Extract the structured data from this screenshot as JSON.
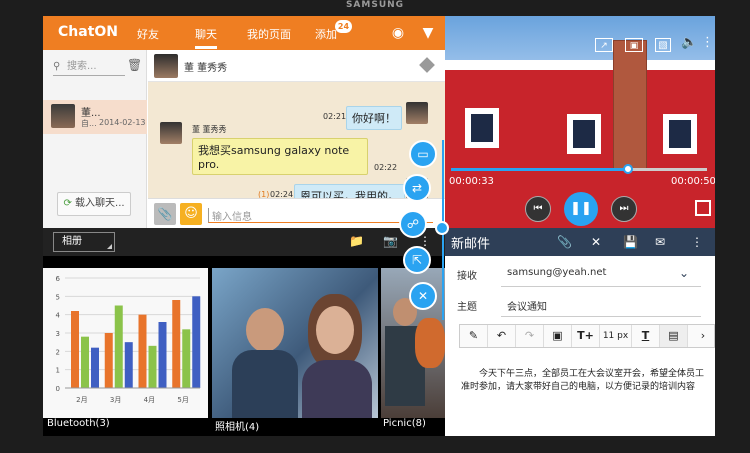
{
  "brand": "SAMSUNG",
  "chaton": {
    "logo": "ChatON",
    "tabs": [
      "好友",
      "聊天",
      "我的页面",
      "添加"
    ],
    "badge": "24",
    "search_placeholder": "搜索...",
    "item": {
      "name": "董...",
      "sub": "自...",
      "date": "2014-02-13"
    },
    "load_label": "载入聊天...",
    "contact": "董 董秀秀",
    "messages": [
      {
        "time": "02:21",
        "text": "你好啊！",
        "side": "right"
      },
      {
        "sender": "董 董秀秀",
        "text": "我想买samsung galaxy note pro.",
        "time": "02:22",
        "side": "left"
      },
      {
        "count": "(1)",
        "time": "02:24",
        "text": "恩可以买，我用的。",
        "side": "right"
      }
    ],
    "input_placeholder": "输入信息"
  },
  "video": {
    "elapsed": "00:00:33",
    "total": "00:00:50",
    "progress": 0.69
  },
  "gallery": {
    "album_label": "相册",
    "captions": [
      "Bluetooth(3)",
      "照相机(4)",
      "Picnic(8)"
    ]
  },
  "chart_data": {
    "type": "bar",
    "categories": [
      "2月",
      "3月",
      "4月",
      "5月"
    ],
    "series": [
      {
        "values": [
          4.2,
          3.0,
          4.0,
          4.8
        ]
      },
      {
        "values": [
          2.8,
          4.5,
          2.3,
          3.2
        ]
      },
      {
        "values": [
          2.2,
          2.5,
          3.6,
          5.0
        ]
      }
    ],
    "ytick_labels": [
      "0",
      "1",
      "2",
      "3",
      "4",
      "5",
      "6"
    ],
    "ylim": [
      0,
      6
    ],
    "grid": true,
    "colors": [
      "#e8742b",
      "#8bc34a",
      "#3f5fc2"
    ]
  },
  "email": {
    "title": "新邮件",
    "to_label": "接收",
    "to_value": "samsung@yeah.net",
    "subject_label": "主题",
    "subject_value": "会议通知",
    "font_size": "11 px",
    "body": "今天下午三点，全部员工在大会议室开会，希望全体员工准时参加，请大家带好自己的电脑，以方便记录的培训内容"
  },
  "colors": {
    "chaton_orange": "#ef7e22",
    "accent_blue": "#2aa3f1",
    "email_bar": "#2e3f57"
  }
}
